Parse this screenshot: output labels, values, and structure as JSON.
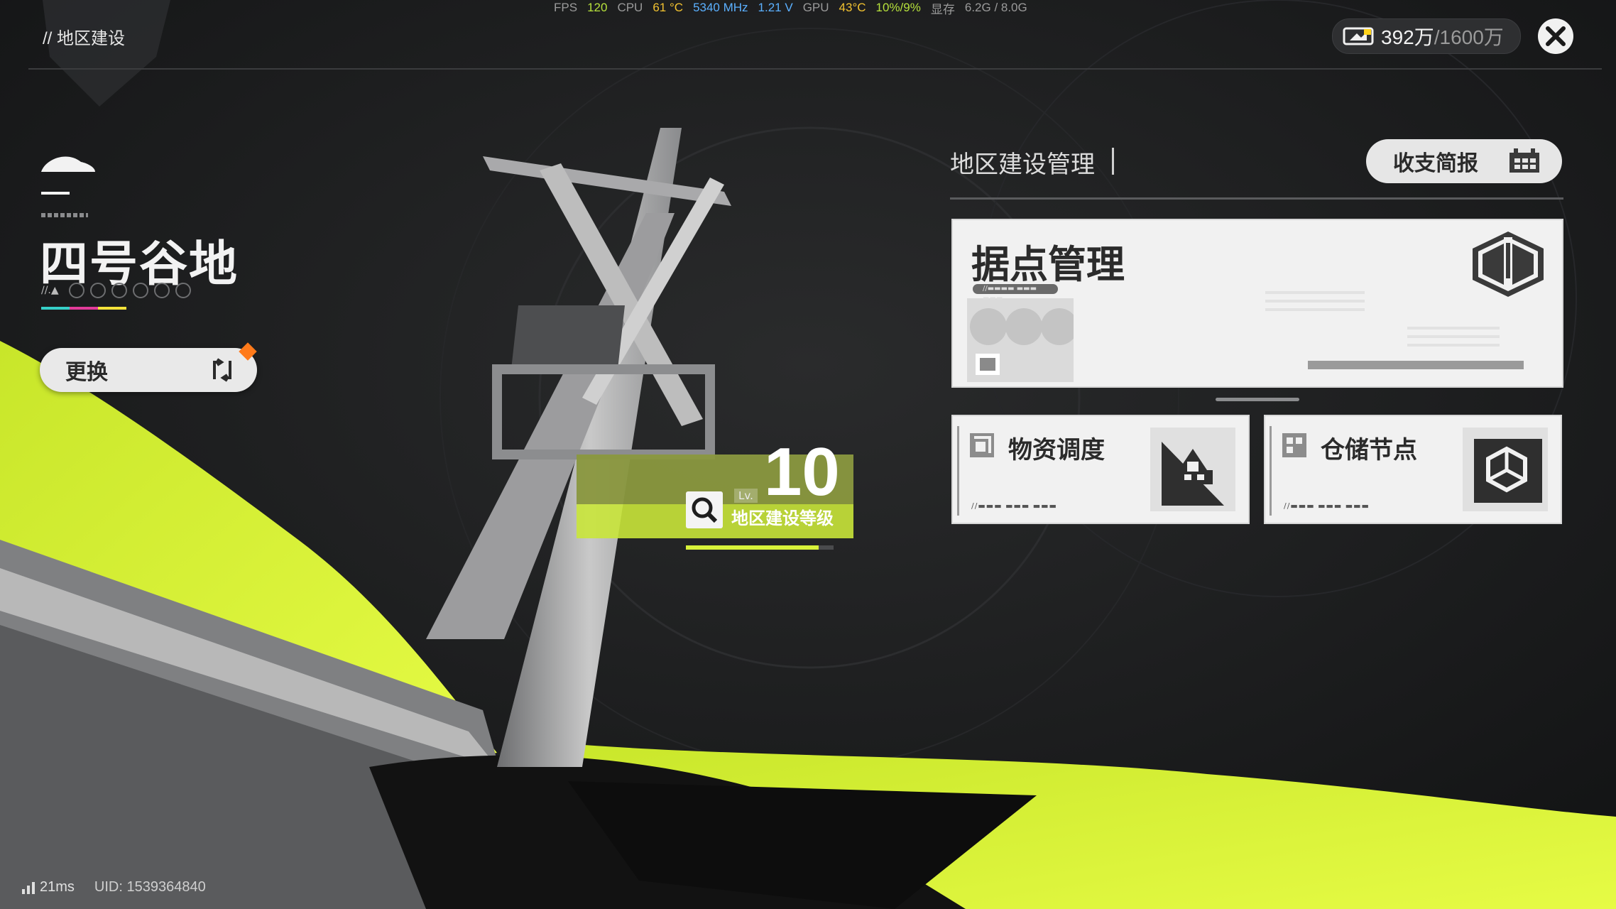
{
  "perf": {
    "fps_label": "FPS",
    "fps": "120",
    "cpu_label": "CPU",
    "cpu_temp": "61 °C",
    "cpu_clock": "5340 MHz",
    "cpu_volt": "1.21 V",
    "gpu_label": "GPU",
    "gpu_temp": "43°C",
    "gpu_usage": "10%/9%",
    "vram_label": "显存",
    "vram": "6.2G / 8.0G"
  },
  "header": {
    "breadcrumb": "// 地区建设",
    "currency_value": "392万",
    "currency_max": "/1600万"
  },
  "region": {
    "name": "四号谷地",
    "lv_mark": "//.▲",
    "change_label": "更换"
  },
  "level": {
    "lv_tag": "Lv.",
    "value": "10",
    "label": "地区建设等级",
    "progress": 0.9
  },
  "management": {
    "section_title": "地区建设管理",
    "report_label": "收支简报",
    "main_card": {
      "title": "据点管理",
      "tag": "//▬▬▬▬ ▬▬▬ ▬▬▬"
    },
    "cards": [
      {
        "title": "物资调度",
        "sub": "//▬▬▬ ▬▬▬ ▬▬▬"
      },
      {
        "title": "仓储节点",
        "sub": "//▬▬▬ ▬▬▬ ▬▬▬"
      }
    ]
  },
  "footer": {
    "ping": "21ms",
    "uid": "UID: 1539364840"
  },
  "colors": {
    "accent": "#d8f23a",
    "badge": "#ff7a1a"
  }
}
